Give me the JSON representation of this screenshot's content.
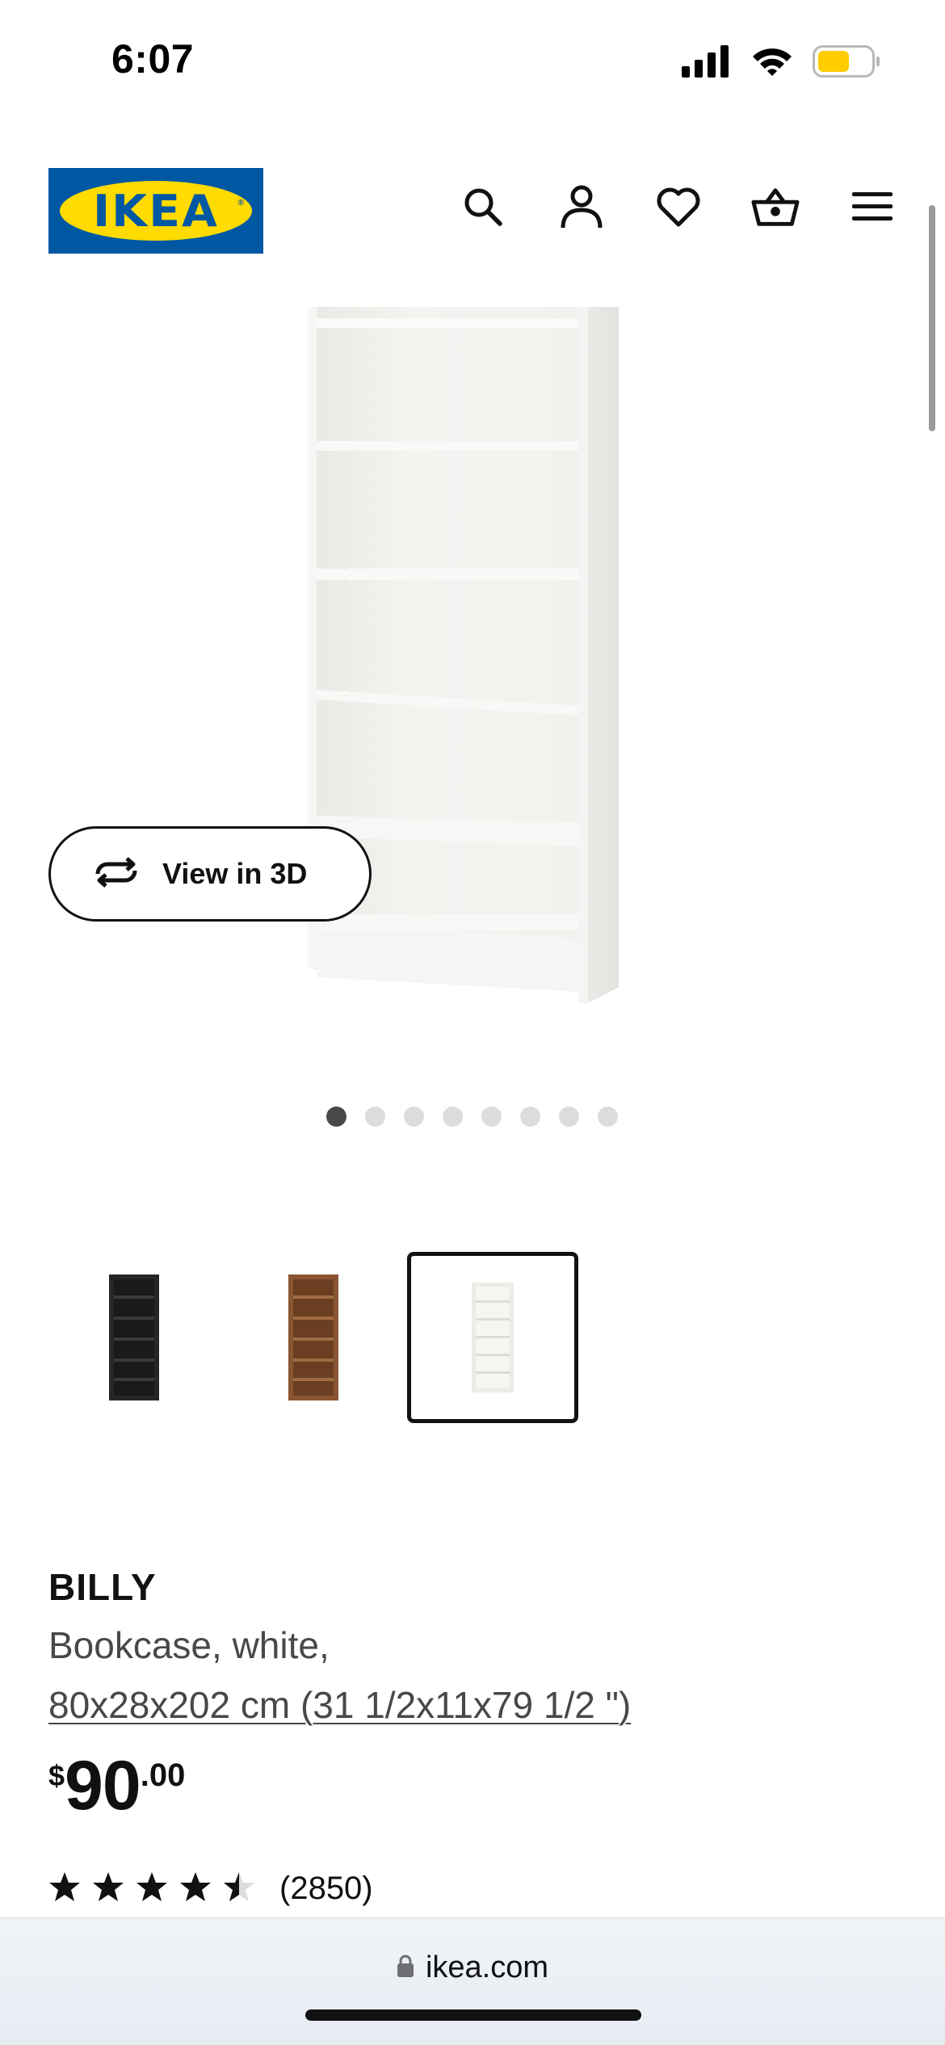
{
  "status_bar": {
    "time": "6:07",
    "icons": [
      "cellular-signal-icon",
      "wifi-icon",
      "battery-icon"
    ],
    "battery_color": "#ffcc00"
  },
  "header": {
    "logo_text": "IKEA",
    "logo_colors": {
      "blue": "#0058a3",
      "yellow": "#ffdb00"
    },
    "icons": [
      "search-icon",
      "account-icon",
      "favorites-heart-icon",
      "shopping-basket-icon",
      "menu-icon"
    ]
  },
  "gallery": {
    "view_3d_label": "View in 3D",
    "view_3d_icon": "rotate-arrows-icon",
    "image_count": 8,
    "active_index": 0
  },
  "variants": [
    {
      "color_name": "black",
      "swatch": "#2a2a2a",
      "selected": false
    },
    {
      "color_name": "brown",
      "swatch": "#7a4a2a",
      "selected": false
    },
    {
      "color_name": "white",
      "swatch": "#f2f2ee",
      "selected": true
    }
  ],
  "product": {
    "name": "BILLY",
    "description": "Bookcase, white,",
    "dimensions": "80x28x202 cm (31 1/2x11x79 1/2 \")",
    "price": {
      "currency": "$",
      "integer": "90",
      "decimal": ".00"
    },
    "rating": {
      "stars": 4.5,
      "max": 5,
      "count_label": "(2850)"
    }
  },
  "browser": {
    "url": "ikea.com",
    "lock_icon": "lock-icon"
  }
}
